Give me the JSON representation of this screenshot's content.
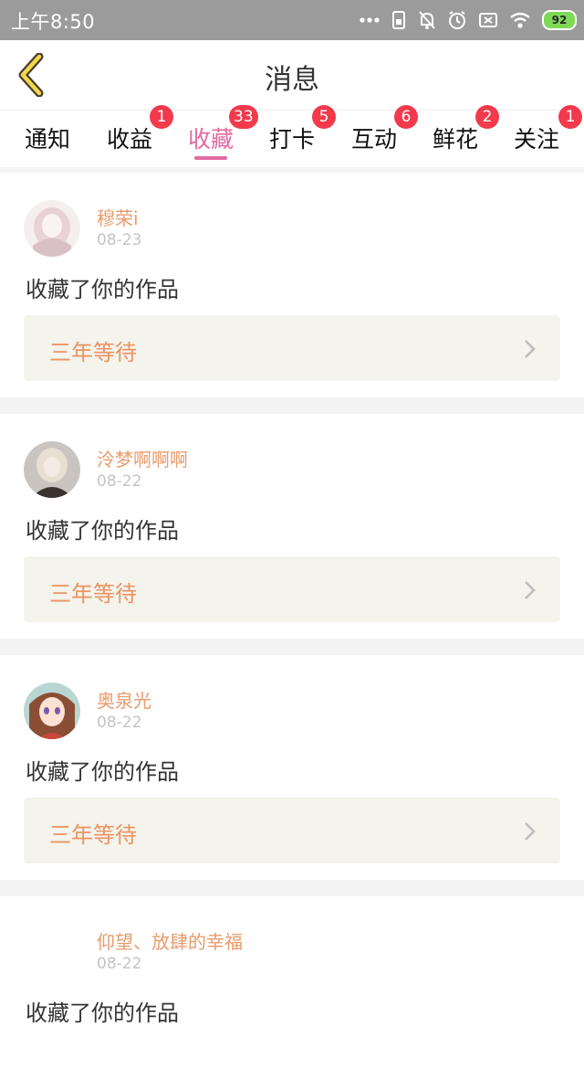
{
  "status_bar": {
    "time": "上午8:50",
    "battery": "92",
    "icons": [
      "more-dots-icon",
      "sim-icon",
      "mute-bell-icon",
      "alarm-icon",
      "no-sim-icon",
      "wifi-icon",
      "battery-icon"
    ]
  },
  "header": {
    "title": "消息",
    "back_icon": "chevron-left-icon"
  },
  "tabs": [
    {
      "label": "通知",
      "badge": ""
    },
    {
      "label": "收益",
      "badge": "1"
    },
    {
      "label": "收藏",
      "badge": "33"
    },
    {
      "label": "打卡",
      "badge": "5"
    },
    {
      "label": "互动",
      "badge": "6"
    },
    {
      "label": "鲜花",
      "badge": "2"
    },
    {
      "label": "关注",
      "badge": "1"
    }
  ],
  "active_tab": "收藏",
  "colors": {
    "accent": "#e06aa2",
    "badge": "#f23a4c",
    "username": "#e99b6b",
    "work_title": "#ea9462",
    "status_bar": "#9b9b9b"
  },
  "items": [
    {
      "user": "穆荣i",
      "date": "08-23",
      "action": "收藏了你的作品",
      "work": "三年等待"
    },
    {
      "user": "泠梦啊啊啊",
      "date": "08-22",
      "action": "收藏了你的作品",
      "work": "三年等待"
    },
    {
      "user": "奥泉光",
      "date": "08-22",
      "action": "收藏了你的作品",
      "work": "三年等待"
    },
    {
      "user": "仰望、放肆的幸福",
      "date": "08-22",
      "action": "收藏了你的作品",
      "work": ""
    }
  ]
}
